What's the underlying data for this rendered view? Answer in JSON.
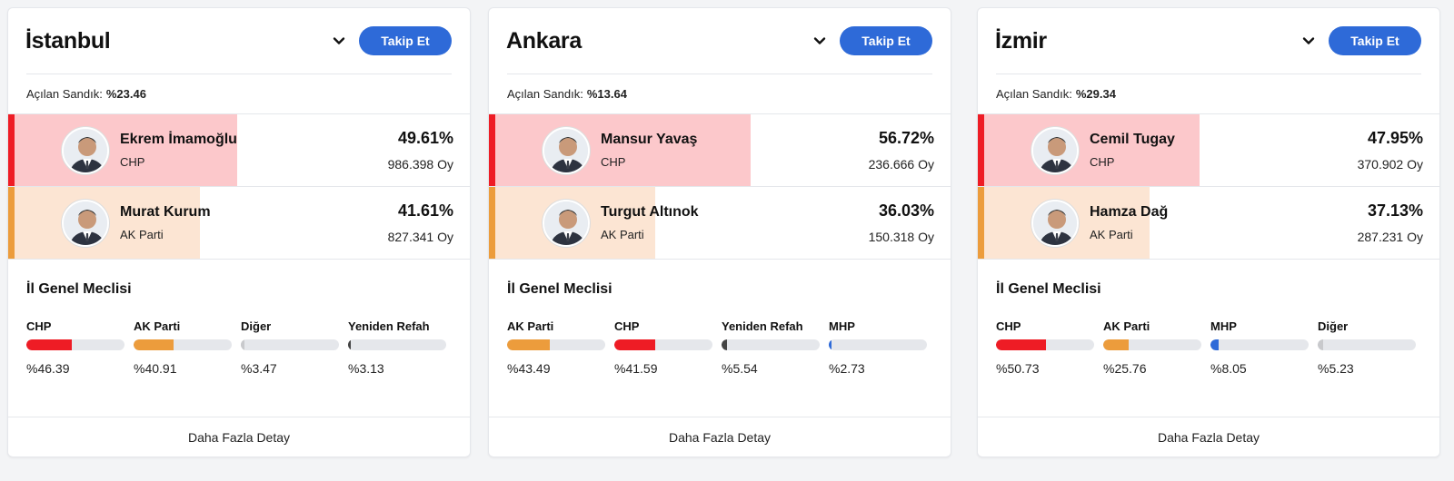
{
  "cards": [
    {
      "city": "İstanbul",
      "follow": "Takip Et",
      "opened_label": "Açılan Sandık:",
      "opened_value": "%23.46",
      "candidates": [
        {
          "name": "Ekrem İmamoğlu",
          "party": "CHP",
          "pct": "49.61%",
          "votes": "986.398 Oy",
          "share": 49.61,
          "fill": "#fcc8cb",
          "accent": "#ee1c25"
        },
        {
          "name": "Murat Kurum",
          "party": "AK Parti",
          "pct": "41.61%",
          "votes": "827.341 Oy",
          "share": 41.61,
          "fill": "#fce5d3",
          "accent": "#ec9c3c"
        }
      ],
      "council_title": "İl Genel Meclisi",
      "council": [
        {
          "name": "CHP",
          "pct": "%46.39",
          "share": 46.39,
          "color": "#ee1c25"
        },
        {
          "name": "AK Parti",
          "pct": "%40.91",
          "share": 40.91,
          "color": "#ec9c3c"
        },
        {
          "name": "Diğer",
          "pct": "%3.47",
          "share": 3.47,
          "color": "#c8c9cc"
        },
        {
          "name": "Yeniden Refah",
          "pct": "%3.13",
          "share": 3.13,
          "color": "#444444"
        }
      ],
      "footer": "Daha Fazla Detay"
    },
    {
      "city": "Ankara",
      "follow": "Takip Et",
      "opened_label": "Açılan Sandık:",
      "opened_value": "%13.64",
      "candidates": [
        {
          "name": "Mansur Yavaş",
          "party": "CHP",
          "pct": "56.72%",
          "votes": "236.666 Oy",
          "share": 56.72,
          "fill": "#fcc8cb",
          "accent": "#ee1c25"
        },
        {
          "name": "Turgut Altınok",
          "party": "AK Parti",
          "pct": "36.03%",
          "votes": "150.318 Oy",
          "share": 36.03,
          "fill": "#fce5d3",
          "accent": "#ec9c3c"
        }
      ],
      "council_title": "İl Genel Meclisi",
      "council": [
        {
          "name": "AK Parti",
          "pct": "%43.49",
          "share": 43.49,
          "color": "#ec9c3c"
        },
        {
          "name": "CHP",
          "pct": "%41.59",
          "share": 41.59,
          "color": "#ee1c25"
        },
        {
          "name": "Yeniden Refah",
          "pct": "%5.54",
          "share": 5.54,
          "color": "#444444"
        },
        {
          "name": "MHP",
          "pct": "%2.73",
          "share": 2.73,
          "color": "#2e6ad8"
        }
      ],
      "footer": "Daha Fazla Detay"
    },
    {
      "city": "İzmir",
      "follow": "Takip Et",
      "opened_label": "Açılan Sandık:",
      "opened_value": "%29.34",
      "candidates": [
        {
          "name": "Cemil Tugay",
          "party": "CHP",
          "pct": "47.95%",
          "votes": "370.902 Oy",
          "share": 47.95,
          "fill": "#fcc8cb",
          "accent": "#ee1c25"
        },
        {
          "name": "Hamza Dağ",
          "party": "AK Parti",
          "pct": "37.13%",
          "votes": "287.231 Oy",
          "share": 37.13,
          "fill": "#fce5d3",
          "accent": "#ec9c3c"
        }
      ],
      "council_title": "İl Genel Meclisi",
      "council": [
        {
          "name": "CHP",
          "pct": "%50.73",
          "share": 50.73,
          "color": "#ee1c25"
        },
        {
          "name": "AK Parti",
          "pct": "%25.76",
          "share": 25.76,
          "color": "#ec9c3c"
        },
        {
          "name": "MHP",
          "pct": "%8.05",
          "share": 8.05,
          "color": "#2e6ad8"
        },
        {
          "name": "Diğer",
          "pct": "%5.23",
          "share": 5.23,
          "color": "#c8c9cc"
        }
      ],
      "footer": "Daha Fazla Detay"
    }
  ]
}
